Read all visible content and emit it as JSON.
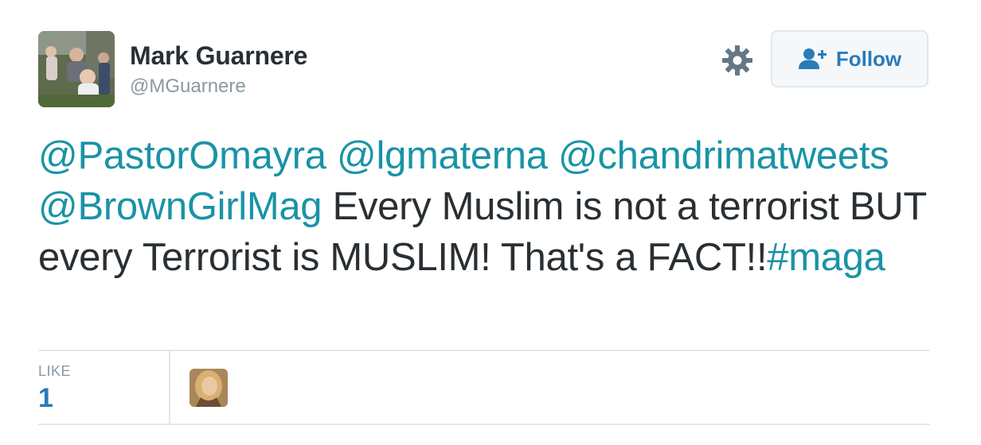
{
  "user": {
    "name": "Mark Guarnere",
    "handle": "@MGuarnere"
  },
  "actions": {
    "follow_label": "Follow",
    "settings_icon": "gear-icon",
    "follow_icon": "user-add-icon"
  },
  "tweet": {
    "mentions": [
      "@PastorOmayra",
      "@lgmaterna",
      "@chandrimatweets",
      "@BrownGirlMag"
    ],
    "body": " Every Muslim is not a terrorist BUT every Terrorist is MUSLIM! That's a FACT!!",
    "hashtag": "#maga"
  },
  "stats": {
    "like_label": "LIKE",
    "like_count": "1"
  },
  "colors": {
    "link": "#1a93a6",
    "text": "#292f33",
    "muted": "#8899a6",
    "divider": "#e1e8ed"
  }
}
